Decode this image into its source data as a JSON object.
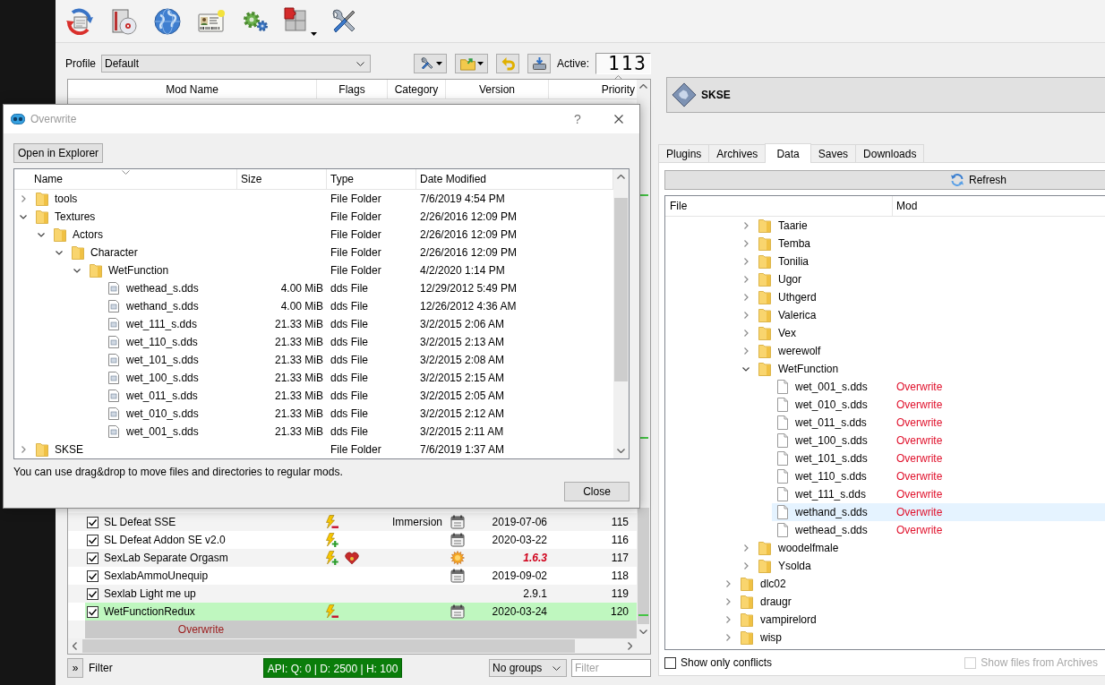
{
  "profile": {
    "label": "Profile",
    "value": "Default",
    "active_label": "Active:",
    "active_count": "113"
  },
  "mod_list": {
    "columns": [
      {
        "label": "Mod Name",
        "sorted": false
      },
      {
        "label": "Flags",
        "sorted": false
      },
      {
        "label": "Category",
        "sorted": false
      },
      {
        "label": "Version",
        "sorted": false
      },
      {
        "label": "Priority",
        "sorted": true,
        "descending": false
      }
    ],
    "rows": [
      {
        "kind": "mod",
        "enabled": true,
        "highlighted": false,
        "name": "SL Defeat SSE",
        "flags": [
          {
            "kind": "overwritten"
          }
        ],
        "category": "Immersion",
        "date_version": true,
        "update_available": false,
        "version": "2019-07-06",
        "priority": "115"
      },
      {
        "kind": "mod",
        "enabled": true,
        "highlighted": false,
        "name": "SL Defeat Addon SE v2.0",
        "flags": [
          {
            "kind": "overwrites"
          }
        ],
        "date_version": true,
        "update_available": false,
        "version": "2020-03-22",
        "priority": "116"
      },
      {
        "kind": "mod",
        "enabled": true,
        "highlighted": false,
        "name": "SexLab Separate Orgasm",
        "flags": [
          {
            "kind": "overwrites"
          },
          {
            "kind": "not_endorsed"
          }
        ],
        "date_version": false,
        "update_available": true,
        "version": "1.6.3",
        "priority": "117"
      },
      {
        "kind": "mod",
        "enabled": true,
        "highlighted": false,
        "name": "SexlabAmmoUnequip",
        "date_version": true,
        "update_available": false,
        "version": "2019-09-02",
        "priority": "118"
      },
      {
        "kind": "mod",
        "enabled": true,
        "highlighted": false,
        "name": "Sexlab Light me up",
        "date_version": false,
        "update_available": false,
        "version": "2.9.1",
        "priority": "119"
      },
      {
        "kind": "mod",
        "enabled": true,
        "highlighted": true,
        "name": "WetFunctionRedux",
        "flags": [
          {
            "kind": "overwritten"
          }
        ],
        "date_version": true,
        "update_available": false,
        "version": "2020-03-24",
        "priority": "120"
      },
      {
        "kind": "overwrite",
        "name": "Overwrite"
      }
    ]
  },
  "bottom_bar": {
    "toggle": "»",
    "filter_label": "Filter",
    "api_status": "API: Q: 0 | D: 2500 | H: 100",
    "groups": "No groups",
    "filter_placeholder": "Filter"
  },
  "executable": {
    "name": "SKSE"
  },
  "tabs": [
    {
      "label": "Plugins",
      "selected": false
    },
    {
      "label": "Archives",
      "selected": false
    },
    {
      "label": "Data",
      "selected": true
    },
    {
      "label": "Saves",
      "selected": false
    },
    {
      "label": "Downloads",
      "selected": false
    }
  ],
  "data_tab": {
    "refresh": "Refresh",
    "columns": [
      "File",
      "Mod"
    ],
    "rows": [
      {
        "children": [
          {
            "kind": "folder",
            "name": "Taarie",
            "expanded": false,
            "selected": false
          },
          {
            "kind": "folder",
            "name": "Temba",
            "expanded": false,
            "selected": false
          },
          {
            "kind": "folder",
            "name": "Tonilia",
            "expanded": false,
            "selected": false
          },
          {
            "kind": "folder",
            "name": "Ugor",
            "expanded": false,
            "selected": false
          },
          {
            "kind": "folder",
            "name": "Uthgerd",
            "expanded": false,
            "selected": false
          },
          {
            "kind": "folder",
            "name": "Valerica",
            "expanded": false,
            "selected": false
          },
          {
            "kind": "folder",
            "name": "Vex",
            "expanded": false,
            "selected": false
          },
          {
            "kind": "folder",
            "name": "werewolf",
            "expanded": false,
            "selected": false
          },
          {
            "kind": "folder",
            "name": "WetFunction",
            "expanded": true,
            "selected": false,
            "children": [
              {
                "kind": "file",
                "name": "wet_001_s.dds",
                "mod": "Overwrite",
                "selected": false
              },
              {
                "kind": "file",
                "name": "wet_010_s.dds",
                "mod": "Overwrite",
                "selected": false
              },
              {
                "kind": "file",
                "name": "wet_011_s.dds",
                "mod": "Overwrite",
                "selected": false
              },
              {
                "kind": "file",
                "name": "wet_100_s.dds",
                "mod": "Overwrite",
                "selected": false
              },
              {
                "kind": "file",
                "name": "wet_101_s.dds",
                "mod": "Overwrite",
                "selected": false
              },
              {
                "kind": "file",
                "name": "wet_110_s.dds",
                "mod": "Overwrite",
                "selected": false
              },
              {
                "kind": "file",
                "name": "wet_111_s.dds",
                "mod": "Overwrite",
                "selected": false
              },
              {
                "kind": "file",
                "name": "wethand_s.dds",
                "mod": "Overwrite",
                "selected": true
              },
              {
                "kind": "file",
                "name": "wethead_s.dds",
                "mod": "Overwrite",
                "selected": false
              }
            ]
          },
          {
            "kind": "folder",
            "name": "woodelfmale",
            "expanded": false,
            "selected": false
          },
          {
            "kind": "folder",
            "name": "Ysolda",
            "expanded": false,
            "selected": false
          }
        ]
      },
      {
        "kind": "folder",
        "name": "dlc02",
        "expanded": false,
        "selected": false
      },
      {
        "kind": "folder",
        "name": "draugr",
        "expanded": false,
        "selected": false
      },
      {
        "kind": "folder",
        "name": "vampirelord",
        "expanded": false,
        "selected": false
      },
      {
        "kind": "folder",
        "name": "wisp",
        "expanded": false,
        "selected": false
      }
    ],
    "options": [
      {
        "label": "Show only conflicts",
        "checked": false,
        "disabled": false
      },
      {
        "label": "Show files from Archives",
        "checked": false,
        "disabled": true
      }
    ]
  },
  "dialog": {
    "title": "Overwrite",
    "help": "?",
    "open_button": "Open in Explorer",
    "columns": [
      {
        "label": "Name",
        "sorted": true,
        "descending": true
      },
      {
        "label": "Size",
        "sorted": false
      },
      {
        "label": "Type",
        "sorted": false
      },
      {
        "label": "Date Modified",
        "sorted": false
      }
    ],
    "rows": [
      {
        "kind": "folder",
        "name": "tools",
        "expanded": false,
        "type": "File Folder",
        "modified": "7/6/2019 4:54 PM"
      },
      {
        "kind": "folder",
        "name": "Textures",
        "expanded": true,
        "type": "File Folder",
        "modified": "2/26/2016 12:09 PM",
        "children": [
          {
            "kind": "folder",
            "name": "Actors",
            "expanded": true,
            "type": "File Folder",
            "modified": "2/26/2016 12:09 PM",
            "children": [
              {
                "kind": "folder",
                "name": "Character",
                "expanded": true,
                "type": "File Folder",
                "modified": "2/26/2016 12:09 PM",
                "children": [
                  {
                    "kind": "folder",
                    "name": "WetFunction",
                    "expanded": true,
                    "type": "File Folder",
                    "modified": "4/2/2020 1:14 PM",
                    "children": [
                      {
                        "kind": "file",
                        "name": "wethead_s.dds",
                        "size": "4.00 MiB",
                        "type": "dds File",
                        "modified": "12/29/2012 5:49 PM"
                      },
                      {
                        "kind": "file",
                        "name": "wethand_s.dds",
                        "size": "4.00 MiB",
                        "type": "dds File",
                        "modified": "12/26/2012 4:36 AM"
                      },
                      {
                        "kind": "file",
                        "name": "wet_111_s.dds",
                        "size": "21.33 MiB",
                        "type": "dds File",
                        "modified": "3/2/2015 2:06 AM"
                      },
                      {
                        "kind": "file",
                        "name": "wet_110_s.dds",
                        "size": "21.33 MiB",
                        "type": "dds File",
                        "modified": "3/2/2015 2:13 AM"
                      },
                      {
                        "kind": "file",
                        "name": "wet_101_s.dds",
                        "size": "21.33 MiB",
                        "type": "dds File",
                        "modified": "3/2/2015 2:08 AM"
                      },
                      {
                        "kind": "file",
                        "name": "wet_100_s.dds",
                        "size": "21.33 MiB",
                        "type": "dds File",
                        "modified": "3/2/2015 2:15 AM"
                      },
                      {
                        "kind": "file",
                        "name": "wet_011_s.dds",
                        "size": "21.33 MiB",
                        "type": "dds File",
                        "modified": "3/2/2015 2:05 AM"
                      },
                      {
                        "kind": "file",
                        "name": "wet_010_s.dds",
                        "size": "21.33 MiB",
                        "type": "dds File",
                        "modified": "3/2/2015 2:12 AM"
                      },
                      {
                        "kind": "file",
                        "name": "wet_001_s.dds",
                        "size": "21.33 MiB",
                        "type": "dds File",
                        "modified": "3/2/2015 2:11 AM"
                      }
                    ]
                  }
                ]
              }
            ]
          }
        ]
      },
      {
        "kind": "folder",
        "name": "SKSE",
        "expanded": false,
        "type": "File Folder",
        "modified": "7/6/2019 1:37 AM"
      }
    ],
    "hint": "You can use drag&drop to move files and directories to regular mods.",
    "close_button": "Close"
  }
}
